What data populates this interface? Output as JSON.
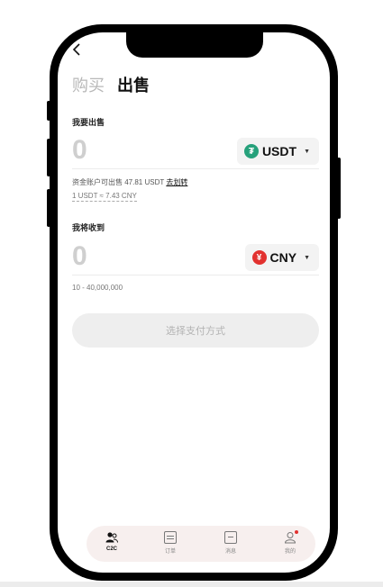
{
  "header": {
    "back_icon": "chevron-left-icon"
  },
  "tabs": [
    {
      "label": "购买",
      "active": false
    },
    {
      "label": "出售",
      "active": true
    }
  ],
  "sell": {
    "label": "我要出售",
    "amount": "0",
    "currency": {
      "code": "USDT",
      "icon": "tether-icon",
      "symbol": "₮",
      "color": "#26a17b"
    },
    "available_text": "资金账户可出售 47.81 USDT",
    "transfer_link": "去划转",
    "rate": "1 USDT ≈ 7.43 CNY"
  },
  "receive": {
    "label": "我将收到",
    "amount": "0",
    "currency": {
      "code": "CNY",
      "icon": "yuan-icon",
      "symbol": "¥",
      "color": "#e2312f"
    },
    "range": "10 - 40,000,000"
  },
  "pay_button": "选择支付方式",
  "bottom_nav": [
    {
      "label": "C2C",
      "icon": "users-icon",
      "active": true
    },
    {
      "label": "订单",
      "icon": "orders-icon",
      "active": false
    },
    {
      "label": "消息",
      "icon": "message-icon",
      "active": false,
      "badge": true
    },
    {
      "label": "我的",
      "icon": "profile-icon",
      "active": false,
      "badge": true
    }
  ]
}
